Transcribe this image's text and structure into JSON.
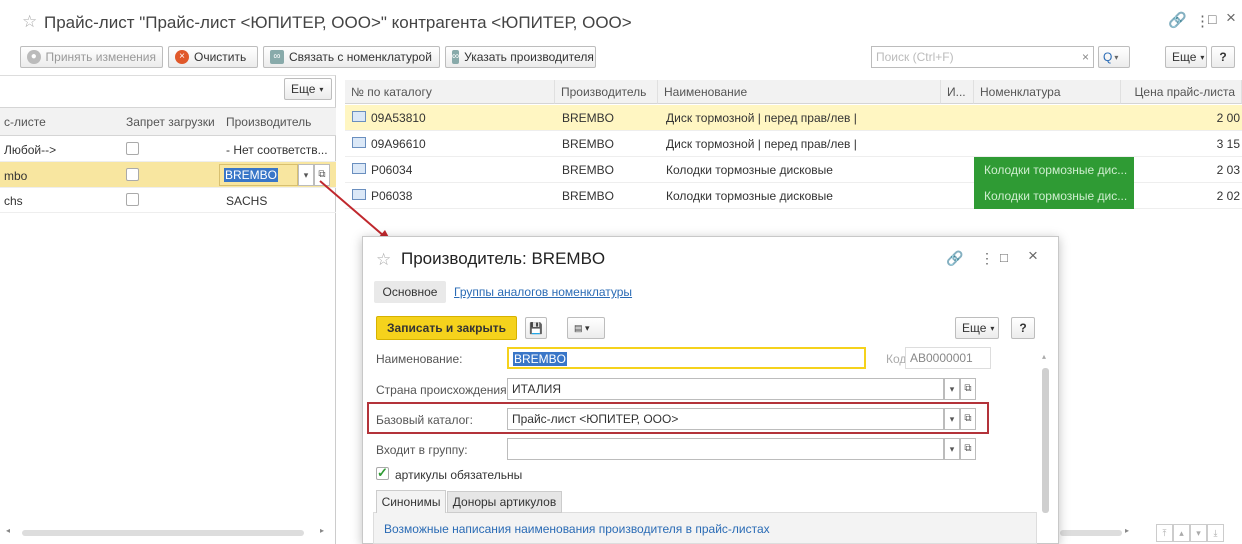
{
  "window": {
    "star": "☆",
    "title": "Прайс-лист \"Прайс-лист <ЮПИТЕР, ООО>\" контрагента <ЮПИТЕР, ООО>",
    "link_icon": "link-icon",
    "more": "⋮",
    "maximize": "□",
    "close": "×"
  },
  "toolbar": {
    "accept": "Принять изменения",
    "clear": "Очистить",
    "link_nomenclature": "Связать с номенклатурой",
    "set_manufacturer": "Указать производителя",
    "search_placeholder": "Поиск (Ctrl+F)",
    "search_clear": "×",
    "search_icon": "Q",
    "more": "Еще",
    "help": "?"
  },
  "left": {
    "more": "Еще",
    "columns": [
      "с-листе",
      "Запрет загрузки",
      "Производитель"
    ],
    "rows": [
      {
        "name": "Любой-->",
        "mfr": "- Нет соответств..."
      },
      {
        "name": "mbo",
        "mfr": "BREMBO"
      },
      {
        "name": "chs",
        "mfr": "SACHS"
      }
    ]
  },
  "right": {
    "columns": [
      "№ по каталогу",
      "Производитель",
      "Наименование",
      "И...",
      "Номенклатура",
      "Цена прайс-листа"
    ],
    "rows": [
      {
        "code": "09A53810",
        "mfr": "BREMBO",
        "name": "Диск тормозной | перед прав/лев |",
        "nom": "",
        "price": "2 00"
      },
      {
        "code": "09A96610",
        "mfr": "BREMBO",
        "name": "Диск тормозной | перед прав/лев |",
        "nom": "",
        "price": "3 15"
      },
      {
        "code": "P06034",
        "mfr": "BREMBO",
        "name": "Колодки тормозные дисковые",
        "nom": "Колодки тормозные дис...",
        "price": "2 03"
      },
      {
        "code": "P06038",
        "mfr": "BREMBO",
        "name": "Колодки тормозные дисковые",
        "nom": "Колодки тормозные дис...",
        "price": "2 02"
      }
    ]
  },
  "dialog": {
    "star": "☆",
    "title": "Производитель: BREMBO",
    "tabs": [
      "Основное",
      "Группы аналогов номенклатуры"
    ],
    "save_close": "Записать и закрыть",
    "more": "Еще",
    "help": "?",
    "name_label": "Наименование:",
    "name_value": "BREMBO",
    "code_label": "Код:",
    "code_value": "АВ0000001",
    "country_label": "Страна происхождения:",
    "country_value": "ИТАЛИЯ",
    "catalog_label": "Базовый каталог:",
    "catalog_value": "Прайс-лист <ЮПИТЕР, ООО>",
    "group_label": "Входит в группу:",
    "group_value": "",
    "articles_label": "артикулы обязательны",
    "articles_checked": true,
    "subtabs": [
      "Синонимы",
      "Доноры артикулов"
    ],
    "synonyms_text": "Возможные написания наименования производителя в прайс-листах"
  },
  "colors": {
    "highlight": "#fff6c2",
    "selected": "#f8e6a0",
    "green": "#2f9b34",
    "accent": "#f5d21c",
    "arrow": "#c0282d",
    "link": "#2a6bb5"
  }
}
